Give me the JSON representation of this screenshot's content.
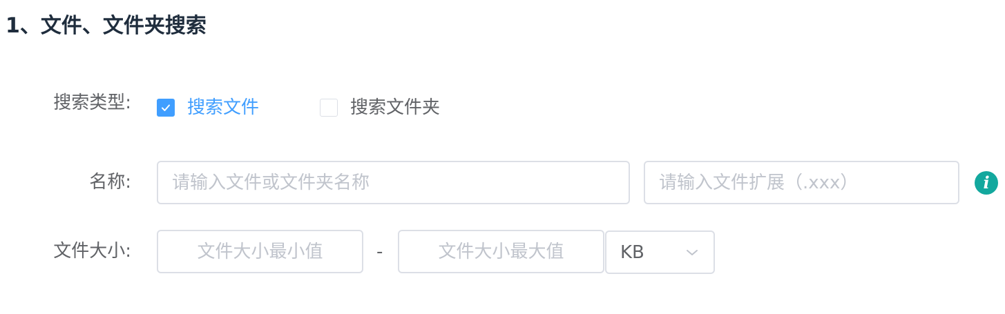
{
  "section": {
    "title": "1、文件、文件夹搜索"
  },
  "form": {
    "search_type": {
      "label": "搜索类型:",
      "options": [
        {
          "label": "搜索文件",
          "checked": true
        },
        {
          "label": "搜索文件夹",
          "checked": false
        }
      ]
    },
    "name": {
      "label": "名称:",
      "name_placeholder": "请输入文件或文件夹名称",
      "ext_placeholder": "请输入文件扩展（.xxx）",
      "info_icon": "i"
    },
    "size": {
      "label": "文件大小:",
      "min_placeholder": "文件大小最小值",
      "separator": "-",
      "max_placeholder": "文件大小最大值",
      "unit": "KB"
    }
  },
  "icons": {
    "check": "check-icon",
    "chevron": "chevron-down-icon",
    "info": "info-icon"
  },
  "colors": {
    "primary": "#409eff",
    "info": "#13a89e",
    "text": "#606266",
    "placeholder": "#c0c4cc",
    "border": "#dcdfe6",
    "title": "#1f2d3d"
  }
}
